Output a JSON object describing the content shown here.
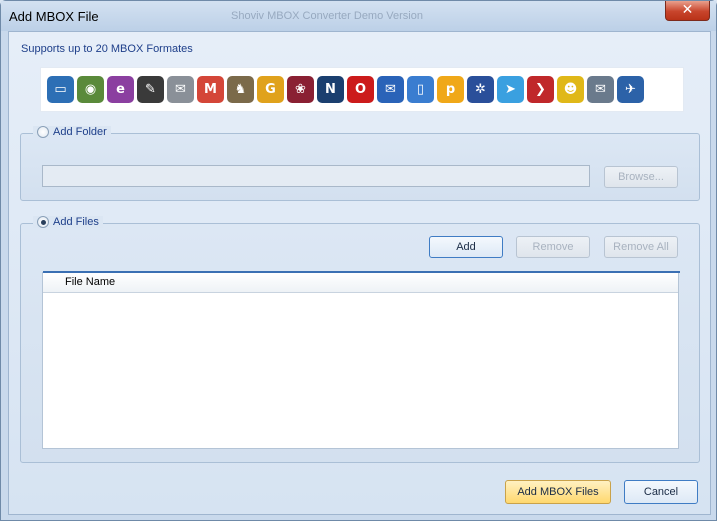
{
  "window": {
    "title": "Add MBOX File",
    "ghost_title": "Shoviv MBOX Converter Demo Version",
    "close_glyph": "✕"
  },
  "supports_text": "Supports up to 20 MBOX Formates",
  "format_icons": [
    {
      "name": "apple-mail-icon",
      "color": "#2d6fb5",
      "glyph": "▭"
    },
    {
      "name": "netscape-globe-icon",
      "color": "#5a8a3a",
      "glyph": "◉"
    },
    {
      "name": "entourage-icon",
      "color": "#8b3fa0",
      "glyph": "e"
    },
    {
      "name": "eudora-icon",
      "color": "#3a3a3a",
      "glyph": "✎"
    },
    {
      "name": "mail-clock-icon",
      "color": "#8a9098",
      "glyph": "✉"
    },
    {
      "name": "gmail-icon",
      "color": "#d44638",
      "glyph": "M"
    },
    {
      "name": "gnu-icon",
      "color": "#7b6a4a",
      "glyph": "♞"
    },
    {
      "name": "g-mail-icon",
      "color": "#e0a21c",
      "glyph": "G"
    },
    {
      "name": "raspberry-icon",
      "color": "#8a2033",
      "glyph": "❀"
    },
    {
      "name": "netscape-icon",
      "color": "#1b3f6f",
      "glyph": "N"
    },
    {
      "name": "opera-icon",
      "color": "#cc1b1b",
      "glyph": "O"
    },
    {
      "name": "postbox-icon",
      "color": "#2a63b8",
      "glyph": "✉"
    },
    {
      "name": "mailbox-icon",
      "color": "#3a7dd0",
      "glyph": "▯"
    },
    {
      "name": "pocomail-icon",
      "color": "#f0a818",
      "glyph": "p"
    },
    {
      "name": "spicebird-icon",
      "color": "#2a4f9a",
      "glyph": "✲"
    },
    {
      "name": "sparrow-icon",
      "color": "#3aa0e0",
      "glyph": "➤"
    },
    {
      "name": "arrow-icon",
      "color": "#c0282a",
      "glyph": "❯"
    },
    {
      "name": "the-bat-icon",
      "color": "#e0b818",
      "glyph": "☻"
    },
    {
      "name": "sylpheed-icon",
      "color": "#6a7a8c",
      "glyph": "✉"
    },
    {
      "name": "thunderbird-icon",
      "color": "#2c62a8",
      "glyph": "✈"
    }
  ],
  "add_folder": {
    "label": "Add Folder",
    "path_value": "",
    "browse_label": "Browse..."
  },
  "add_files": {
    "label": "Add Files",
    "add_label": "Add",
    "remove_label": "Remove",
    "remove_all_label": "Remove All",
    "column_header": "File Name",
    "rows": []
  },
  "footer": {
    "add_mbox_label": "Add MBOX Files",
    "cancel_label": "Cancel"
  }
}
